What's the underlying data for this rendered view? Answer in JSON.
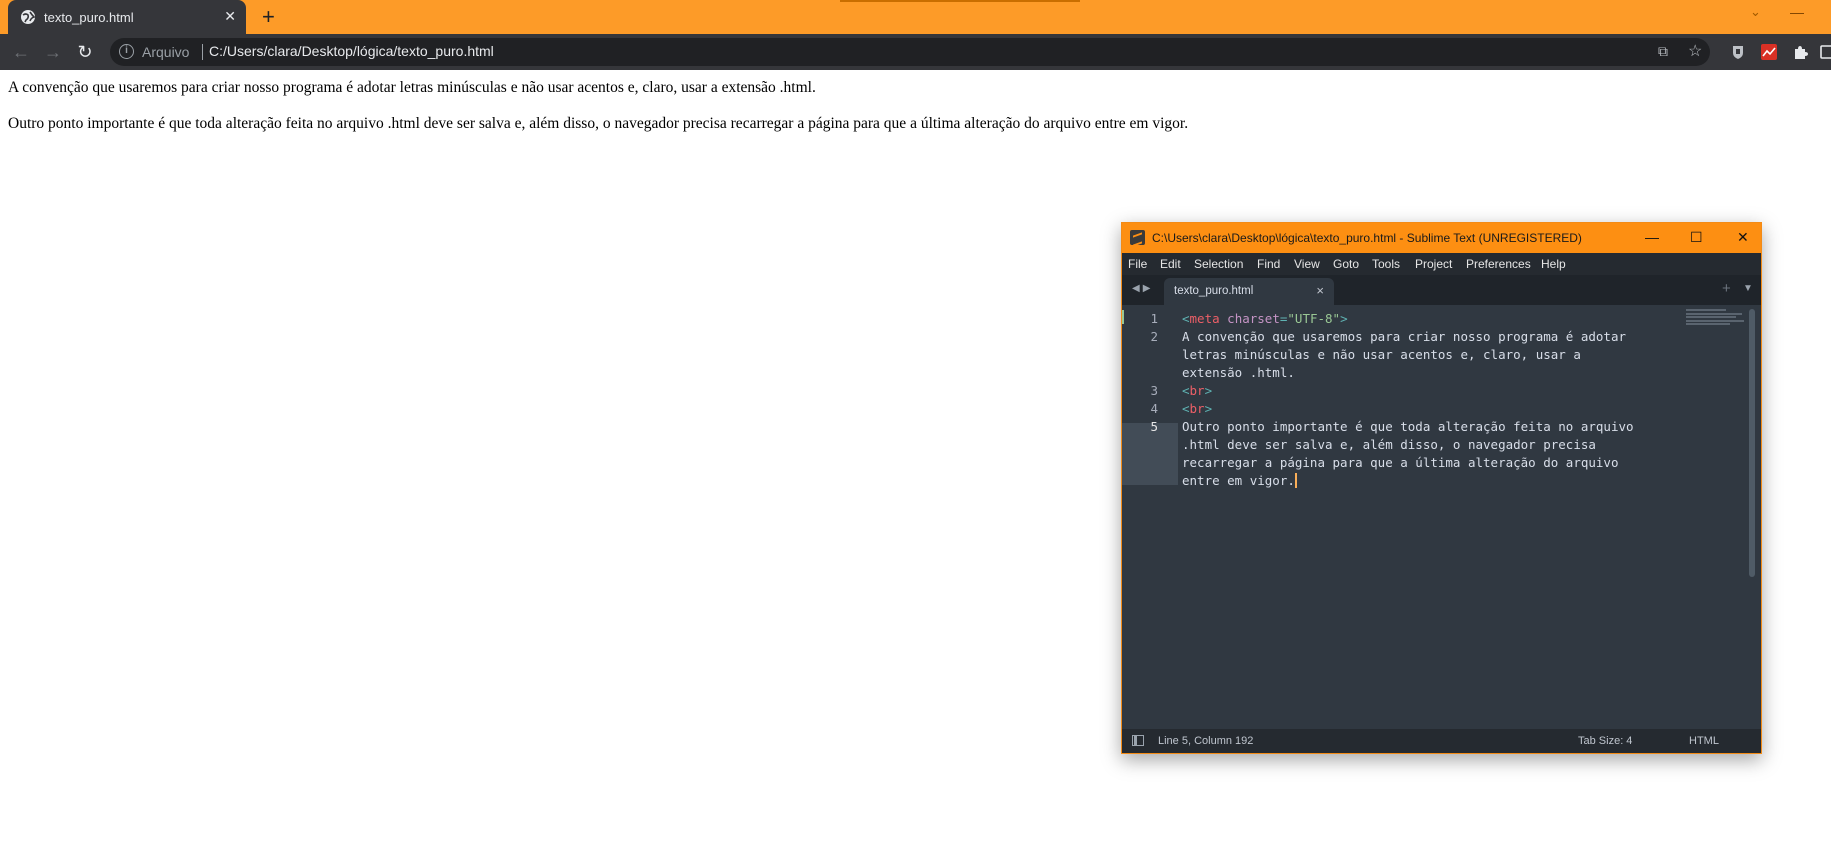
{
  "browser": {
    "tab": {
      "title": "texto_puro.html",
      "close": "✕"
    },
    "new_tab": "+",
    "omnibox": {
      "scheme": "Arquivo",
      "url": "C:/Users/clara/Desktop/lógica/texto_puro.html"
    },
    "theme_color": "#fd9b28"
  },
  "page": {
    "paragraphs": [
      "A convenção que usaremos para criar nosso programa é adotar letras minúsculas e não usar acentos e, claro, usar a extensão .html.",
      "Outro ponto importante é que toda alteração feita no arquivo .html deve ser salva e, além disso, o navegador precisa recarregar a página para que a última alteração do arquivo entre em vigor."
    ]
  },
  "editor": {
    "window_title": "C:\\Users\\clara\\Desktop\\lógica\\texto_puro.html - Sublime Text (UNREGISTERED)",
    "menu": [
      "File",
      "Edit",
      "Selection",
      "Find",
      "View",
      "Goto",
      "Tools",
      "Project",
      "Preferences",
      "Help"
    ],
    "tab": {
      "name": "texto_puro.html",
      "close": "×"
    },
    "line_numbers": [
      "1",
      "2",
      "3",
      "4",
      "5"
    ],
    "code": {
      "l1": {
        "open": "<",
        "tag": "meta",
        "attr": " charset",
        "eq": "=",
        "val": "\"UTF-8\"",
        "close": ">"
      },
      "l2": [
        "A convenção que usaremos para criar nosso programa é adotar",
        "letras minúsculas e não usar acentos e, claro, usar a",
        "extensão .html."
      ],
      "l3": {
        "open": "<",
        "tag": "br",
        "close": ">"
      },
      "l4": {
        "open": "<",
        "tag": "br",
        "close": ">"
      },
      "l5": [
        "Outro ponto importante é que toda alteração feita no arquivo",
        ".html deve ser salva e, além disso, o navegador precisa",
        "recarregar a página para que a última alteração do arquivo",
        "entre em vigor."
      ]
    },
    "status": {
      "position": "Line 5, Column 192",
      "tab_size": "Tab Size: 4",
      "syntax": "HTML"
    },
    "accent_color": "#fd8f12"
  }
}
